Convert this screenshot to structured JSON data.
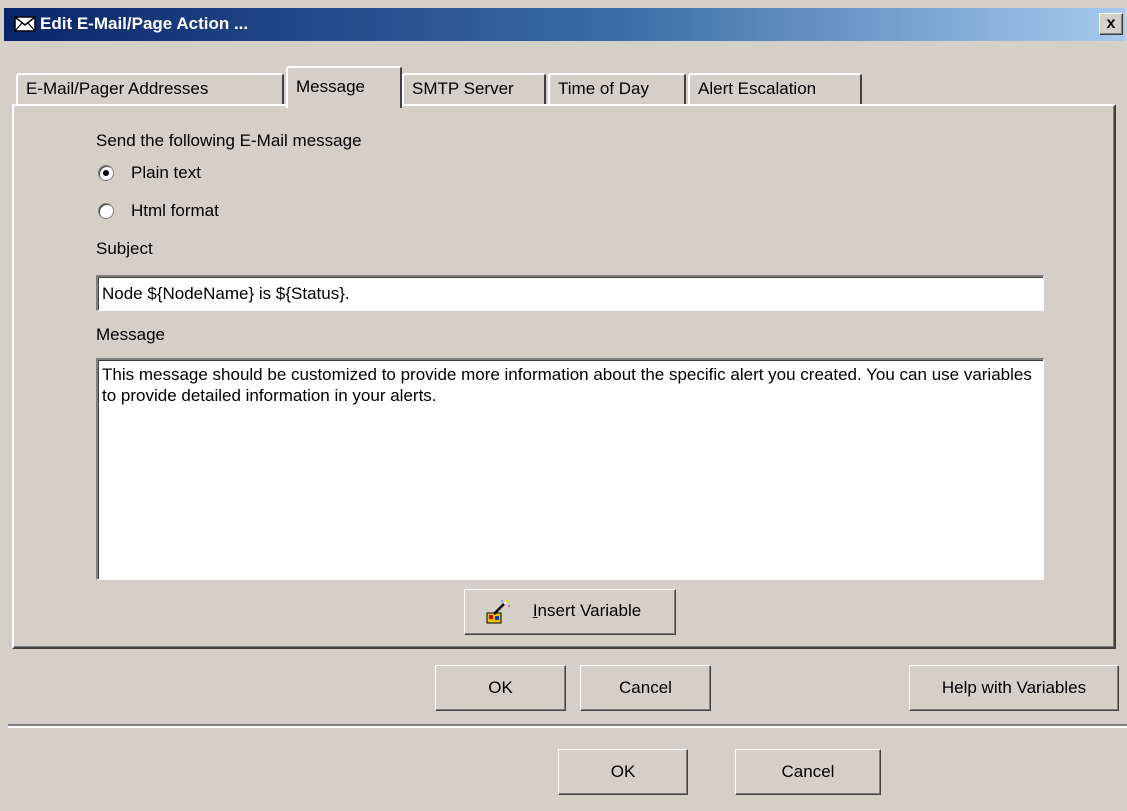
{
  "window": {
    "title": "Edit E-Mail/Page Action ...",
    "close_label": "x"
  },
  "tabs": [
    {
      "label": "E-Mail/Pager Addresses",
      "selected": false
    },
    {
      "label": "Message",
      "selected": true
    },
    {
      "label": "SMTP Server",
      "selected": false
    },
    {
      "label": "Time of Day",
      "selected": false
    },
    {
      "label": "Alert Escalation",
      "selected": false
    }
  ],
  "message_tab": {
    "format_heading": "Send the following E-Mail message",
    "format_options": [
      {
        "label": "Plain text",
        "selected": true
      },
      {
        "label": "Html format",
        "selected": false
      }
    ],
    "subject_label": "Subject",
    "subject_value": "Node ${NodeName} is ${Status}.",
    "message_label": "Message",
    "message_value": "This message should be customized to provide more information about the specific alert you created. You can use variables to provide detailed information in your alerts.",
    "insert_variable_label": "Insert Variable",
    "insert_variable_accel": "I",
    "insert_variable_rest": "nsert Variable"
  },
  "dialog_buttons": {
    "ok": "OK",
    "cancel": "Cancel",
    "help_with_variables": "Help with Variables"
  },
  "outer_buttons": {
    "ok": "OK",
    "cancel": "Cancel"
  },
  "colors": {
    "face": "#d4d0c8",
    "title_start": "#0a246a",
    "title_end": "#a6caf0"
  }
}
